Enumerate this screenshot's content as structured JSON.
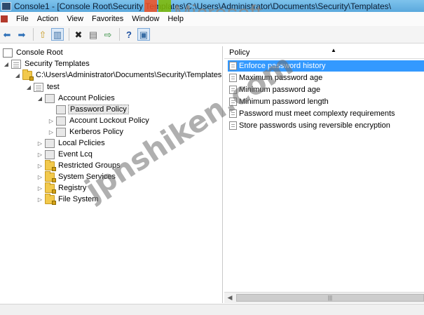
{
  "window": {
    "title": "Console1 - [Console Root\\Security Templates\\C:\\Users\\Administrator\\Documents\\Security\\Templates\\"
  },
  "watermarks": {
    "brand": "Microsoft",
    "brand_colors": [
      "#f25022",
      "#7fba00",
      "#00a4ef",
      "#ffb900"
    ],
    "diagonal": "jpnshiken.com"
  },
  "menu": [
    "File",
    "Action",
    "View",
    "Favorites",
    "Window",
    "Help"
  ],
  "toolbar": [
    "back-icon",
    "forward-icon",
    "up-folder-icon",
    "show-hide-tree-icon",
    "delete-icon",
    "properties-icon",
    "export-icon",
    "help-icon",
    "panel-icon"
  ],
  "tree": {
    "console_root": "Console Root",
    "security_templates": "Security Templates",
    "templates_path": "C:\\Users\\Administrator\\Documents\\Security\\Templates",
    "template": "test",
    "account_policies": "Account Policies",
    "password_policy": "Password Policy",
    "account_lockout_policy": "Account Lockout Policy",
    "kerberos_policy": "Kerberos Policy",
    "local_policies": "Local Pclicies",
    "event_log": "Event Lcq",
    "restricted_groups": "Restricted Groups",
    "system_services": "System Services",
    "registry": "Registry",
    "file_system": "File System"
  },
  "list": {
    "column_header": "Policy",
    "items": [
      "Enforce password history",
      "Maximum password age",
      "Minimum password age",
      "Minimum password length",
      "Password must meet complexty requirements",
      "Store passwords using reversible encryption"
    ],
    "selected_index": 0,
    "selection_color": "#3399ff"
  }
}
